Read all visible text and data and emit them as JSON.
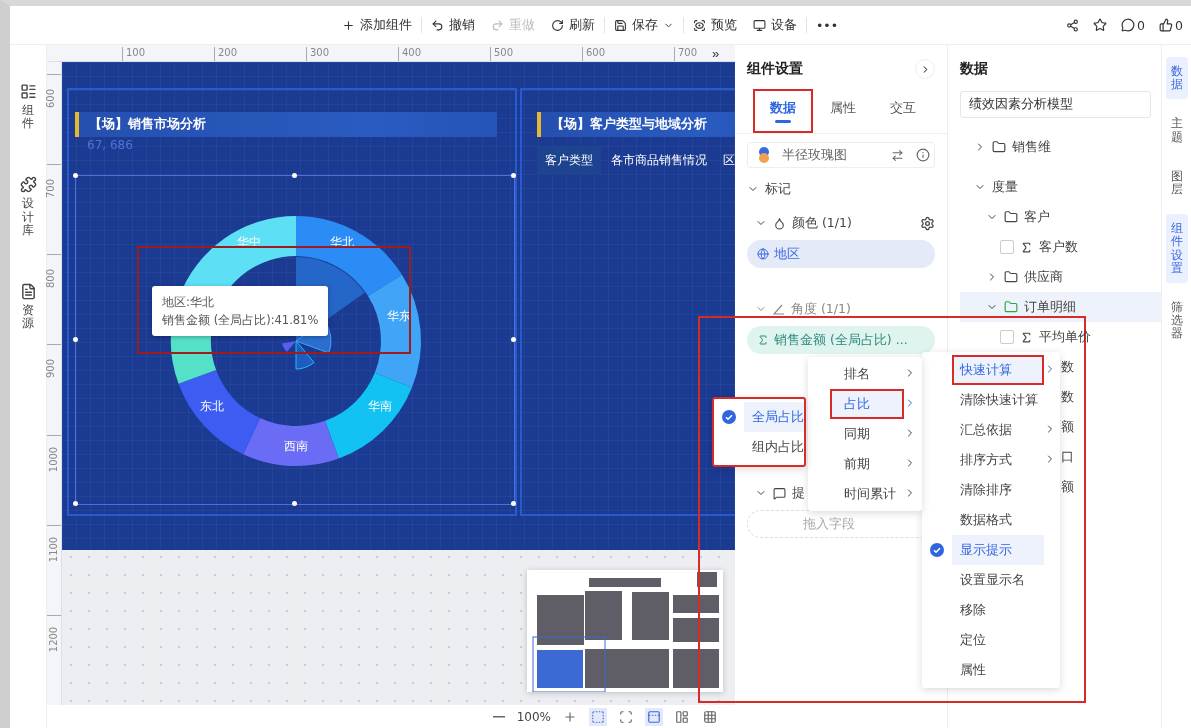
{
  "toolbar": {
    "actions": [
      {
        "label": "添加组件",
        "disabled": false
      },
      {
        "label": "撤销",
        "disabled": false
      },
      {
        "label": "重做",
        "disabled": true
      },
      {
        "label": "刷新",
        "disabled": false
      },
      {
        "label": "保存",
        "disabled": false,
        "dropdown": true
      },
      {
        "label": "预览",
        "disabled": false
      },
      {
        "label": "设备",
        "disabled": false
      }
    ],
    "more": "•••",
    "comments": "0",
    "likes": "0"
  },
  "left_rail": [
    {
      "label": "组件"
    },
    {
      "label": "设计库"
    },
    {
      "label": "资源"
    }
  ],
  "ruler": {
    "x_labels": [
      "100",
      "200",
      "300",
      "400",
      "500",
      "600",
      "700"
    ],
    "y_labels": [
      "600",
      "700",
      "800",
      "900",
      "1000",
      "1100",
      "1200"
    ],
    "more": "»"
  },
  "widgets": [
    {
      "title": "【场】销售市场分析",
      "coords": "67, 686",
      "segments": [
        {
          "label": "华北",
          "color": "#2b8cf5"
        },
        {
          "label": "华东",
          "color": "#40a4f7"
        },
        {
          "label": "华南",
          "color": "#12c2f2"
        },
        {
          "label": "西南",
          "color": "#6b6cf5"
        },
        {
          "label": "东北",
          "color": "#3d5cf2"
        },
        {
          "color": "#55e0c8"
        },
        {
          "label": "华中",
          "color": "#5de0f5"
        }
      ],
      "tooltip": {
        "lines": [
          "地区:华北",
          "销售金额 (全局占比):41.81%"
        ],
        "highlighted": true
      }
    },
    {
      "title": "【场】客户类型与地域分析",
      "tabs": [
        {
          "label": "客户类型",
          "selected": true
        },
        {
          "label": "各市商品销售情况",
          "selected": false
        },
        {
          "label": "区",
          "selected": false
        }
      ]
    }
  ],
  "zoom_bar": {
    "value": "100%",
    "views": [
      {
        "selected": true
      },
      {
        "selected": false
      },
      {
        "selected": false
      }
    ]
  },
  "settings": {
    "title": "组件设置",
    "tabs": [
      {
        "label": "数据",
        "selected": true,
        "highlighted": true
      },
      {
        "label": "属性",
        "selected": false,
        "highlighted": false
      },
      {
        "label": "交互",
        "selected": false,
        "highlighted": false
      }
    ],
    "chart_type": "半径玫瑰图",
    "section": "标记",
    "color_slot": {
      "label": "颜色 (1/1)",
      "field": "地区"
    },
    "angle_slot": {
      "label": "角度 (1/1)",
      "field": "销售金额 (全局占比) ..."
    },
    "tip_slot": {
      "label": "提",
      "placeholder": "拖入字段"
    }
  },
  "data": {
    "title": "数据",
    "model": "绩效因素分析模型",
    "tree": [
      {
        "label": "销售维",
        "kind": "folder",
        "expanded": false
      },
      {
        "label": "度量",
        "kind": "group",
        "expanded": true,
        "children": [
          {
            "label": "客户",
            "kind": "folder",
            "expanded": true,
            "children": [
              {
                "label": "客户数",
                "kind": "field",
                "checked": false
              }
            ]
          },
          {
            "label": "供应商",
            "kind": "folder",
            "expanded": false
          },
          {
            "label": "订单明细",
            "kind": "folder",
            "expanded": true,
            "selected": true,
            "children": [
              {
                "label": "平均单价",
                "kind": "field",
                "checked": false
              },
              {
                "label": "数",
                "kind": "fragment"
              },
              {
                "label": "数",
                "kind": "fragment"
              },
              {
                "label": "额",
                "kind": "fragment"
              },
              {
                "label": "口",
                "kind": "fragment"
              },
              {
                "label": "额",
                "kind": "fragment"
              }
            ]
          }
        ]
      }
    ]
  },
  "right_rail": [
    {
      "label": "数据",
      "selected": true
    },
    {
      "label": "主题",
      "selected": false
    },
    {
      "label": "图层",
      "selected": false
    },
    {
      "label": "组件设置",
      "selected": true
    },
    {
      "label": "筛选器",
      "selected": false
    }
  ],
  "menus": {
    "highlighted": true,
    "percent": {
      "highlighted": true,
      "items": [
        {
          "label": "全局占比",
          "checked": true,
          "selected": true
        },
        {
          "label": "组内占比",
          "checked": false,
          "selected": false
        }
      ]
    },
    "calc": {
      "items": [
        {
          "label": "排名",
          "selected": false,
          "highlighted": false
        },
        {
          "label": "占比",
          "selected": true,
          "highlighted": true
        },
        {
          "label": "同期",
          "selected": false,
          "highlighted": false
        },
        {
          "label": "前期",
          "selected": false,
          "highlighted": false
        },
        {
          "label": "时间累计",
          "selected": false,
          "highlighted": false
        }
      ]
    },
    "field": {
      "items": [
        {
          "label": "快速计算",
          "submenu": true,
          "checked": false,
          "selected": true,
          "highlighted": true
        },
        {
          "label": "清除快速计算",
          "submenu": false,
          "checked": false,
          "selected": false,
          "highlighted": false
        },
        {
          "label": "汇总依据",
          "submenu": true,
          "checked": false,
          "selected": false,
          "highlighted": false
        },
        {
          "label": "排序方式",
          "submenu": true,
          "checked": false,
          "selected": false,
          "highlighted": false
        },
        {
          "label": "清除排序",
          "submenu": false,
          "checked": false,
          "selected": false,
          "highlighted": false
        },
        {
          "label": "数据格式",
          "submenu": false,
          "checked": false,
          "selected": false,
          "highlighted": false
        },
        {
          "label": "显示提示",
          "submenu": false,
          "checked": true,
          "selected": true,
          "highlighted": false
        },
        {
          "label": "设置显示名",
          "submenu": false,
          "checked": false,
          "selected": false,
          "highlighted": false
        },
        {
          "label": "移除",
          "submenu": false,
          "checked": false,
          "selected": false,
          "highlighted": false
        },
        {
          "label": "定位",
          "submenu": false,
          "checked": false,
          "selected": false,
          "highlighted": false
        },
        {
          "label": "属性",
          "submenu": false,
          "checked": false,
          "selected": false,
          "highlighted": false
        }
      ]
    }
  }
}
